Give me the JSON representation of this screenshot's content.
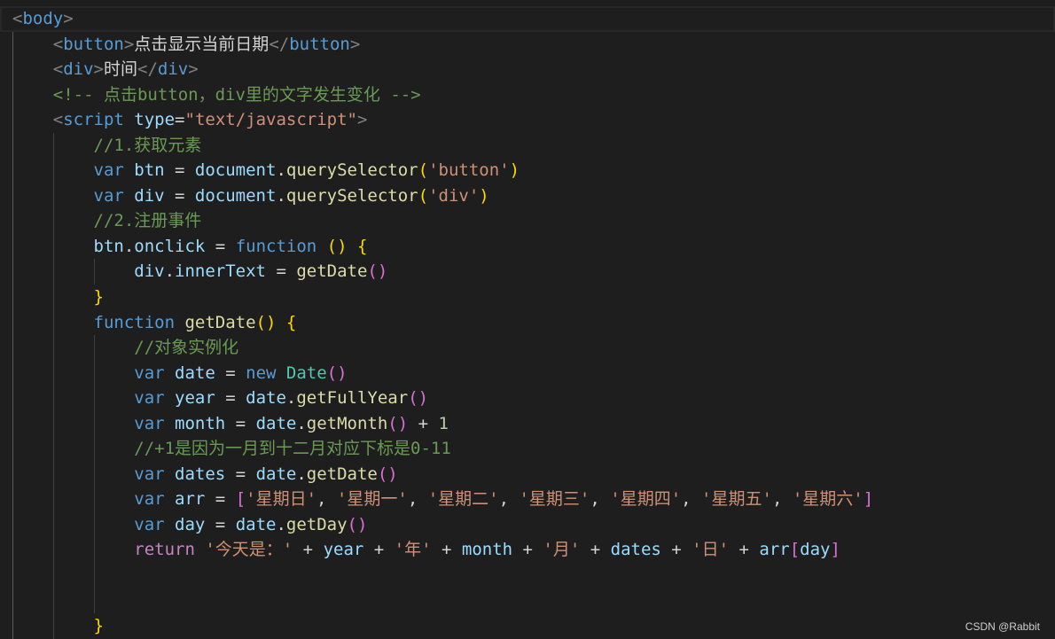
{
  "editor": {
    "theme": {
      "background": "#1e1e1e",
      "indent_guide": "#404040",
      "indent_guide_active": "#5a5a5a",
      "line_highlight_border": "#282828"
    },
    "lines": [
      {
        "indent": 0,
        "current": true,
        "tokens": [
          [
            "<",
            "#808080"
          ],
          [
            "body",
            "#569cd6"
          ],
          [
            ">",
            "#808080"
          ]
        ]
      },
      {
        "indent": 1,
        "tokens": [
          [
            "<",
            "#808080"
          ],
          [
            "button",
            "#569cd6"
          ],
          [
            ">",
            "#808080"
          ],
          [
            "点击显示当前日期",
            "#d4d4d4"
          ],
          [
            "</",
            "#808080"
          ],
          [
            "button",
            "#569cd6"
          ],
          [
            ">",
            "#808080"
          ]
        ]
      },
      {
        "indent": 1,
        "tokens": [
          [
            "<",
            "#808080"
          ],
          [
            "div",
            "#569cd6"
          ],
          [
            ">",
            "#808080"
          ],
          [
            "时间",
            "#d4d4d4"
          ],
          [
            "</",
            "#808080"
          ],
          [
            "div",
            "#569cd6"
          ],
          [
            ">",
            "#808080"
          ]
        ]
      },
      {
        "indent": 1,
        "tokens": [
          [
            "<!-- 点击button，div里的文字发生变化 -->",
            "#6a9955"
          ]
        ]
      },
      {
        "indent": 1,
        "tokens": [
          [
            "<",
            "#808080"
          ],
          [
            "script ",
            "#569cd6"
          ],
          [
            "type",
            "#9cdcfe"
          ],
          [
            "=",
            "#d4d4d4"
          ],
          [
            "\"text/javascript\"",
            "#ce9178"
          ],
          [
            ">",
            "#808080"
          ]
        ]
      },
      {
        "indent": 2,
        "tokens": [
          [
            "//1.获取元素",
            "#6a9955"
          ]
        ]
      },
      {
        "indent": 2,
        "tokens": [
          [
            "var ",
            "#569cd6"
          ],
          [
            "btn",
            "#9cdcfe"
          ],
          [
            " = ",
            "#d4d4d4"
          ],
          [
            "document",
            "#9cdcfe"
          ],
          [
            ".",
            "#d4d4d4"
          ],
          [
            "querySelector",
            "#dcdcaa"
          ],
          [
            "(",
            "#ffd700"
          ],
          [
            "'button'",
            "#ce9178"
          ],
          [
            ")",
            "#ffd700"
          ]
        ]
      },
      {
        "indent": 2,
        "tokens": [
          [
            "var ",
            "#569cd6"
          ],
          [
            "div",
            "#9cdcfe"
          ],
          [
            " = ",
            "#d4d4d4"
          ],
          [
            "document",
            "#9cdcfe"
          ],
          [
            ".",
            "#d4d4d4"
          ],
          [
            "querySelector",
            "#dcdcaa"
          ],
          [
            "(",
            "#ffd700"
          ],
          [
            "'div'",
            "#ce9178"
          ],
          [
            ")",
            "#ffd700"
          ]
        ]
      },
      {
        "indent": 2,
        "tokens": [
          [
            "//2.注册事件",
            "#6a9955"
          ]
        ]
      },
      {
        "indent": 2,
        "tokens": [
          [
            "btn",
            "#9cdcfe"
          ],
          [
            ".",
            "#d4d4d4"
          ],
          [
            "onclick",
            "#9cdcfe"
          ],
          [
            " = ",
            "#d4d4d4"
          ],
          [
            "function ",
            "#569cd6"
          ],
          [
            "()",
            "#ffd700"
          ],
          [
            " {",
            "#ffd700"
          ]
        ]
      },
      {
        "indent": 3,
        "tokens": [
          [
            "div",
            "#9cdcfe"
          ],
          [
            ".",
            "#d4d4d4"
          ],
          [
            "innerText",
            "#9cdcfe"
          ],
          [
            " = ",
            "#d4d4d4"
          ],
          [
            "getDate",
            "#dcdcaa"
          ],
          [
            "()",
            "#da70d6"
          ]
        ]
      },
      {
        "indent": 2,
        "tokens": [
          [
            "}",
            "#ffd700"
          ]
        ]
      },
      {
        "indent": 2,
        "tokens": [
          [
            "function ",
            "#569cd6"
          ],
          [
            "getDate",
            "#dcdcaa"
          ],
          [
            "()",
            "#ffd700"
          ],
          [
            " {",
            "#ffd700"
          ]
        ]
      },
      {
        "indent": 3,
        "tokens": [
          [
            "//对象实例化",
            "#6a9955"
          ]
        ]
      },
      {
        "indent": 3,
        "tokens": [
          [
            "var ",
            "#569cd6"
          ],
          [
            "date",
            "#9cdcfe"
          ],
          [
            " = ",
            "#d4d4d4"
          ],
          [
            "new ",
            "#569cd6"
          ],
          [
            "Date",
            "#4ec9b0"
          ],
          [
            "()",
            "#da70d6"
          ]
        ]
      },
      {
        "indent": 3,
        "tokens": [
          [
            "var ",
            "#569cd6"
          ],
          [
            "year",
            "#9cdcfe"
          ],
          [
            " = ",
            "#d4d4d4"
          ],
          [
            "date",
            "#9cdcfe"
          ],
          [
            ".",
            "#d4d4d4"
          ],
          [
            "getFullYear",
            "#dcdcaa"
          ],
          [
            "()",
            "#da70d6"
          ]
        ]
      },
      {
        "indent": 3,
        "tokens": [
          [
            "var ",
            "#569cd6"
          ],
          [
            "month",
            "#9cdcfe"
          ],
          [
            " = ",
            "#d4d4d4"
          ],
          [
            "date",
            "#9cdcfe"
          ],
          [
            ".",
            "#d4d4d4"
          ],
          [
            "getMonth",
            "#dcdcaa"
          ],
          [
            "()",
            "#da70d6"
          ],
          [
            " + ",
            "#d4d4d4"
          ],
          [
            "1",
            "#b5cea8"
          ]
        ]
      },
      {
        "indent": 3,
        "tokens": [
          [
            "//+1是因为一月到十二月对应下标是0-11",
            "#6a9955"
          ]
        ]
      },
      {
        "indent": 3,
        "tokens": [
          [
            "var ",
            "#569cd6"
          ],
          [
            "dates",
            "#9cdcfe"
          ],
          [
            " = ",
            "#d4d4d4"
          ],
          [
            "date",
            "#9cdcfe"
          ],
          [
            ".",
            "#d4d4d4"
          ],
          [
            "getDate",
            "#dcdcaa"
          ],
          [
            "()",
            "#da70d6"
          ]
        ]
      },
      {
        "indent": 3,
        "tokens": [
          [
            "var ",
            "#569cd6"
          ],
          [
            "arr",
            "#9cdcfe"
          ],
          [
            " = ",
            "#d4d4d4"
          ],
          [
            "[",
            "#da70d6"
          ],
          [
            "'星期日'",
            "#ce9178"
          ],
          [
            ", ",
            "#d4d4d4"
          ],
          [
            "'星期一'",
            "#ce9178"
          ],
          [
            ", ",
            "#d4d4d4"
          ],
          [
            "'星期二'",
            "#ce9178"
          ],
          [
            ", ",
            "#d4d4d4"
          ],
          [
            "'星期三'",
            "#ce9178"
          ],
          [
            ", ",
            "#d4d4d4"
          ],
          [
            "'星期四'",
            "#ce9178"
          ],
          [
            ", ",
            "#d4d4d4"
          ],
          [
            "'星期五'",
            "#ce9178"
          ],
          [
            ", ",
            "#d4d4d4"
          ],
          [
            "'星期六'",
            "#ce9178"
          ],
          [
            "]",
            "#da70d6"
          ]
        ]
      },
      {
        "indent": 3,
        "tokens": [
          [
            "var ",
            "#569cd6"
          ],
          [
            "day",
            "#9cdcfe"
          ],
          [
            " = ",
            "#d4d4d4"
          ],
          [
            "date",
            "#9cdcfe"
          ],
          [
            ".",
            "#d4d4d4"
          ],
          [
            "getDay",
            "#dcdcaa"
          ],
          [
            "()",
            "#da70d6"
          ]
        ]
      },
      {
        "indent": 3,
        "tokens": [
          [
            "return ",
            "#c586c0"
          ],
          [
            "'今天是：'",
            "#ce9178"
          ],
          [
            " + ",
            "#d4d4d4"
          ],
          [
            "year",
            "#9cdcfe"
          ],
          [
            " + ",
            "#d4d4d4"
          ],
          [
            "'年'",
            "#ce9178"
          ],
          [
            " + ",
            "#d4d4d4"
          ],
          [
            "month",
            "#9cdcfe"
          ],
          [
            " + ",
            "#d4d4d4"
          ],
          [
            "'月'",
            "#ce9178"
          ],
          [
            " + ",
            "#d4d4d4"
          ],
          [
            "dates",
            "#9cdcfe"
          ],
          [
            " + ",
            "#d4d4d4"
          ],
          [
            "'日'",
            "#ce9178"
          ],
          [
            " + ",
            "#d4d4d4"
          ],
          [
            "arr",
            "#9cdcfe"
          ],
          [
            "[",
            "#da70d6"
          ],
          [
            "day",
            "#9cdcfe"
          ],
          [
            "]",
            "#da70d6"
          ]
        ]
      },
      {
        "indent": 3,
        "tokens": []
      },
      {
        "indent": 3,
        "tokens": []
      },
      {
        "indent": 2,
        "tokens": [
          [
            "}",
            "#ffd700"
          ]
        ]
      }
    ]
  },
  "watermark": "CSDN @Rabbit"
}
